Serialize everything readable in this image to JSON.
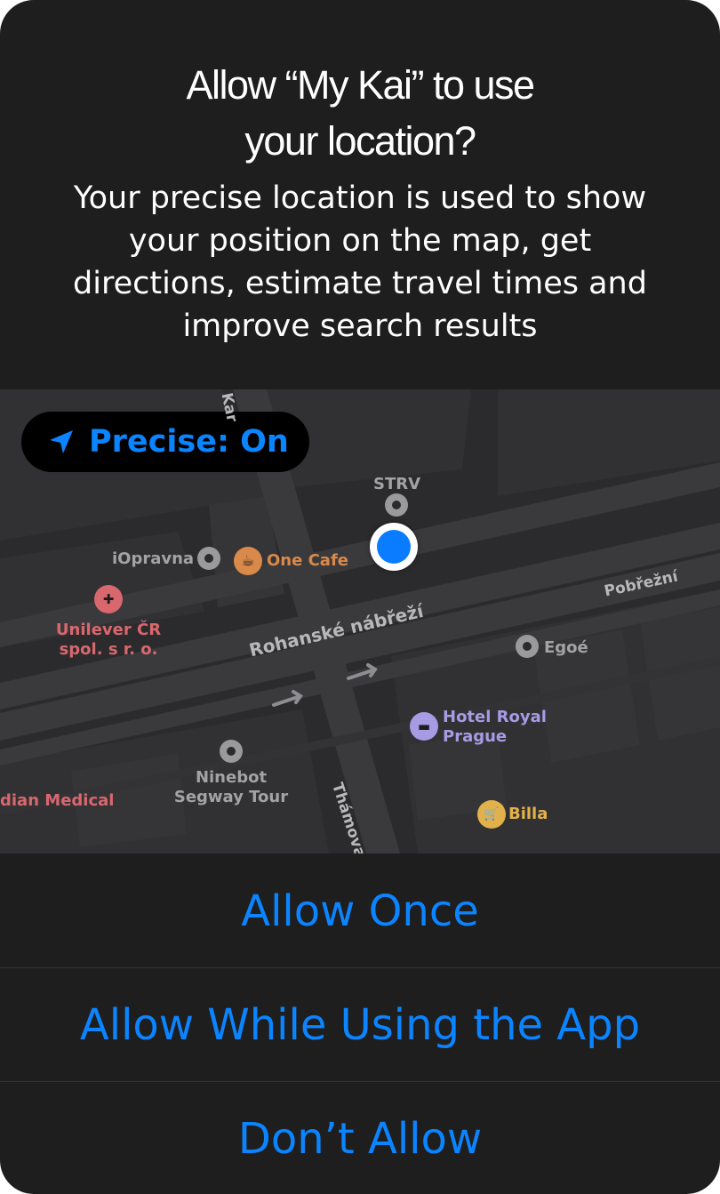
{
  "dialog": {
    "title_line1": "Allow “My  Kai” to use",
    "title_line2": "your location?",
    "message_lines": [
      "Your precise location is used to show",
      "your position on the map, get",
      "directions, estimate travel times and",
      "improve search results"
    ]
  },
  "map": {
    "precise_toggle": {
      "label": "Precise: On",
      "icon": "location-arrow-icon"
    },
    "streets": {
      "main": "Rohanské nábřeží",
      "east": "Pobřežní",
      "cross": "Thámova",
      "top": "Kar"
    },
    "pois": {
      "strv": "STRV",
      "iopravna": "iOpravna",
      "one_cafe": "One Cafe",
      "unilever_line1": "Unilever ČR",
      "unilever_line2": "spol. s r. o.",
      "egoe": "Egoé",
      "hotel_line1": "Hotel Royal",
      "hotel_line2": "Prague",
      "ninebot_line1": "Ninebot",
      "ninebot_line2": "Segway Tour",
      "medical": "dian Medical",
      "billa": "Billa"
    },
    "poi_icons": {
      "cafe": "coffee-cup-icon",
      "pharmacy": "pill-icon",
      "hotel": "bed-icon",
      "shop": "shopping-cart-icon"
    }
  },
  "actions": {
    "allow_once": "Allow Once",
    "allow_while_using": "Allow While Using the App",
    "dont_allow": "Don’t Allow"
  },
  "colors": {
    "accent": "#0a84ff",
    "dialog_bg": "#1e1e1e",
    "map_bg": "#2b2b2d"
  }
}
